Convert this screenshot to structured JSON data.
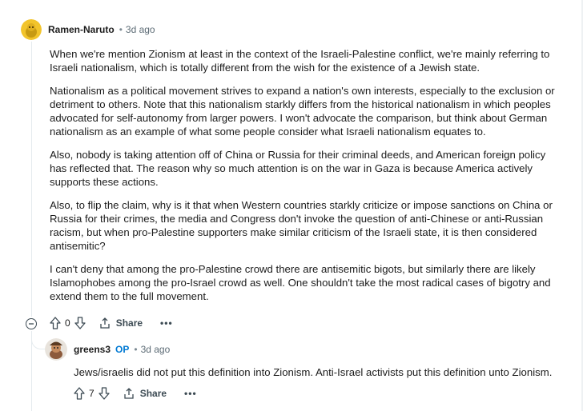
{
  "comment": {
    "author": "Ramen-Naruto",
    "separator": "•",
    "time": "3d ago",
    "paragraphs": [
      "When we're mention Zionism at least in the context of the Israeli-Palestine conflict, we're mainly referring to Israeli nationalism, which is totally different from the wish for the existence of a Jewish state.",
      "Nationalism as a political movement strives to expand a nation's own interests, especially to the exclusion or detriment to others. Note that this nationalism starkly differs from the historical nationalism in which peoples advocated for self-autonomy from larger powers. I won't advocate the comparison, but think about German nationalism as an example of what some people consider what Israeli nationalism equates to.",
      "Also, nobody is taking attention off of China or Russia for their criminal deeds, and American foreign policy has reflected that. The reason why so much attention is on the war in Gaza is because America actively supports these actions.",
      "Also, to flip the claim, why is it that when Western countries starkly criticize or impose sanctions on China or Russia for their crimes, the media and Congress don't invoke the question of anti-Chinese or anti-Russian racism, but when pro-Palestine supporters make similar criticism of the Israeli state, it is then considered antisemitic?",
      "I can't deny that among the pro-Palestine crowd there are antisemitic bigots, but similarly there are likely Islamophobes among the pro-Israel crowd as well. One shouldn't take the most radical cases of bigotry and extend them to the full movement."
    ],
    "votes": "0",
    "share_label": "Share",
    "more_label": "•••"
  },
  "reply": {
    "author": "greens3",
    "badge": "OP",
    "separator": "•",
    "time": "3d ago",
    "text": "Jews/israelis did not put this definition into Zionism. Anti-Israel activists put this definition unto Zionism.",
    "votes": "7",
    "share_label": "Share",
    "more_label": "•••"
  },
  "colors": {
    "accent": "#0079d3",
    "avatar_main": "#f2c42c",
    "thread": "#e5ebee"
  }
}
